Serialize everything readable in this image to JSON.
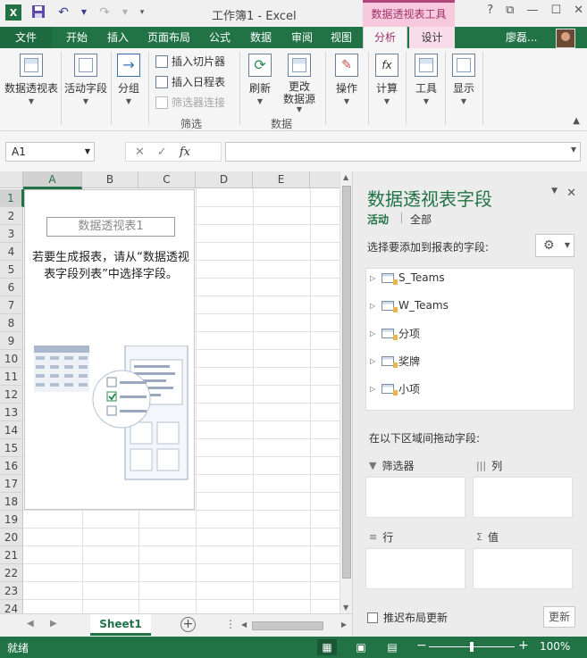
{
  "title_bar": {
    "logo_text": "X",
    "document_title": "工作簿1 - Excel",
    "context_group": "数据透视表工具",
    "controls": [
      "?",
      "⧉",
      "—",
      "☐",
      "✕"
    ]
  },
  "tabs": {
    "file": "文件",
    "items": [
      "开始",
      "插入",
      "页面布局",
      "公式",
      "数据",
      "审阅",
      "视图"
    ],
    "context_items": [
      "分析",
      "设计"
    ],
    "user": "廖磊..."
  },
  "ribbon": {
    "pivottable": "数据透视表",
    "active_field": "活动字段",
    "group": "分组",
    "insert_slicer": "插入切片器",
    "insert_timeline": "插入日程表",
    "filter_connections": "筛选器连接",
    "filter_group_label": "筛选",
    "refresh": "刷新",
    "change_source_l1": "更改",
    "change_source_l2": "数据源",
    "data_group_label": "数据",
    "actions": "操作",
    "calculations": "计算",
    "tools": "工具",
    "show": "显示"
  },
  "formula_bar": {
    "name_box": "A1",
    "cancel": "✕",
    "enter": "✓",
    "fx": "fx",
    "value": ""
  },
  "grid": {
    "columns": [
      "A",
      "B",
      "C",
      "D",
      "E"
    ],
    "rows": [
      "1",
      "2",
      "3",
      "4",
      "5",
      "6",
      "7",
      "8",
      "9",
      "10",
      "11",
      "12",
      "13",
      "14",
      "15",
      "16",
      "17",
      "18",
      "19",
      "20",
      "21",
      "22",
      "23",
      "24"
    ]
  },
  "pivot_placeholder": {
    "title": "数据透视表1",
    "instruction": "若要生成报表，请从“数据透视表字段列表”中选择字段。"
  },
  "sheet_tabs": {
    "active": "Sheet1",
    "add": "+",
    "more": "⋮"
  },
  "task_pane": {
    "title": "数据透视表字段",
    "tab_active": "活动",
    "tab_all": "全部",
    "choose_label": "选择要添加到报表的字段:",
    "fields": [
      "S_Teams",
      "W_Teams",
      "分项",
      "奖牌",
      "小项"
    ],
    "drag_label": "在以下区域间拖动字段:",
    "areas": {
      "filters": "筛选器",
      "columns": "列",
      "rows": "行",
      "values": "值"
    },
    "defer_label": "推迟布局更新",
    "update_button": "更新"
  },
  "status_bar": {
    "ready": "就绪",
    "zoom": "100%",
    "zoom_fraction": 0.5
  },
  "colors": {
    "excel_green": "#217346",
    "context_pink": "#a0306a"
  }
}
